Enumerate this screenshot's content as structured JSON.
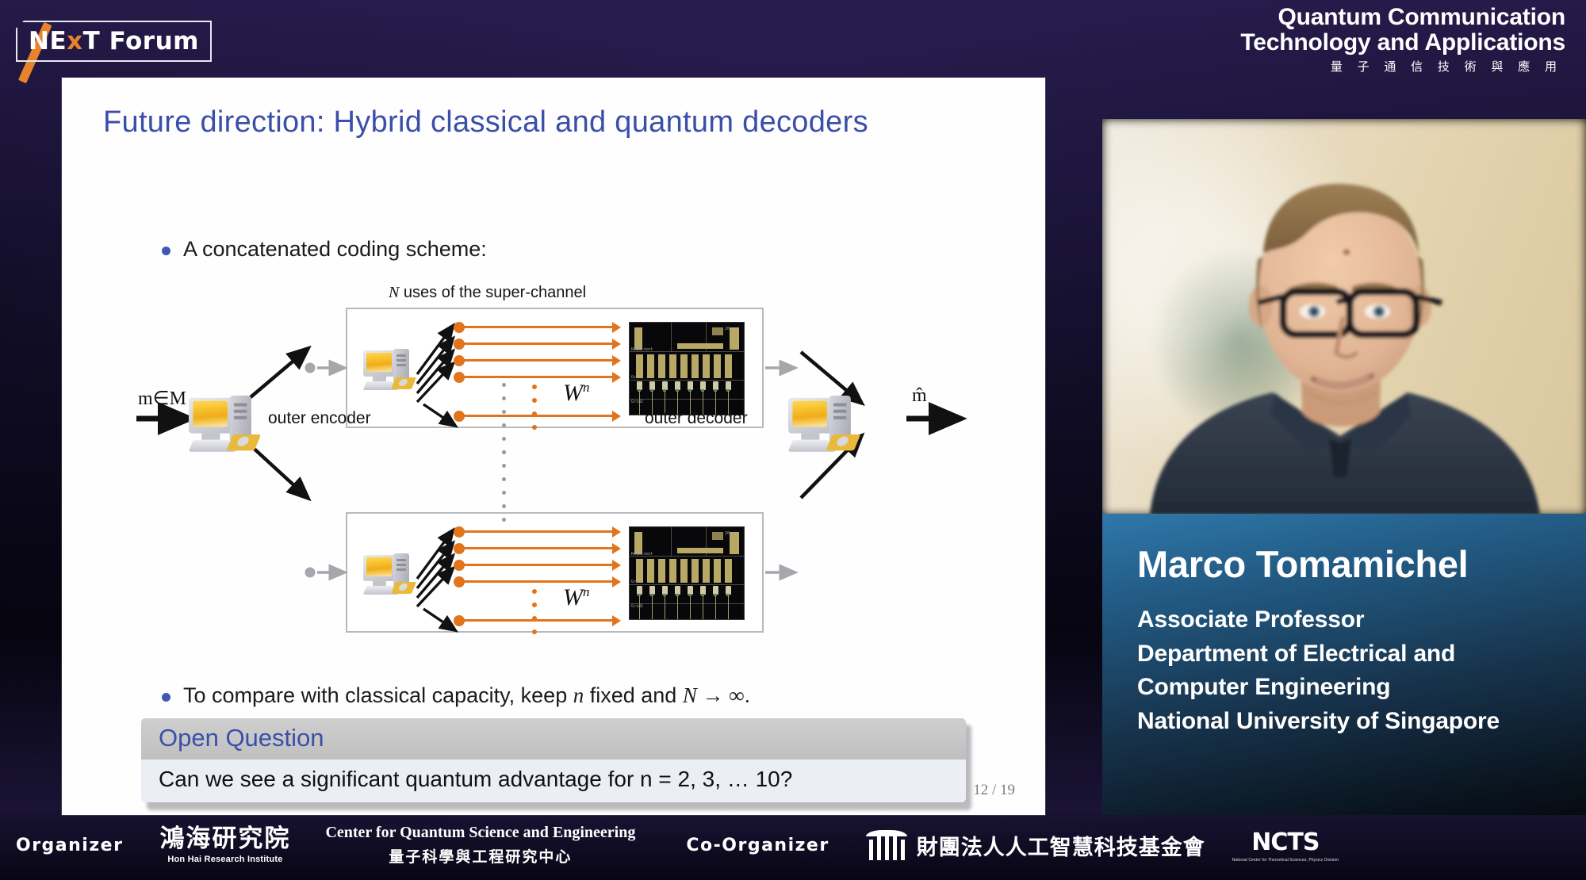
{
  "header": {
    "logo": {
      "pre": "NE",
      "x": "x",
      "post": "T Forum",
      "alt": "NExT Forum"
    },
    "conference": {
      "line1": "Quantum Communication",
      "line2": "Technology and Applications",
      "line3": "量 子 通 信 技 術 與 應 用"
    }
  },
  "slide": {
    "title": "Future direction: Hybrid classical and quantum decoders",
    "bullets": [
      {
        "text_before": "A concatenated coding scheme:"
      },
      {
        "text_before": "To compare with classical capacity, keep ",
        "math1": "n",
        "text_mid": " fixed and ",
        "math2": "N → ∞",
        "text_after": "."
      }
    ],
    "diagram": {
      "supercap_label_math": "N",
      "supercap_label_text": " uses of the super-channel",
      "input_label": "m∈M",
      "output_label": "m̂",
      "encoder_label": "outer encoder",
      "decoder_label": "outer decoder",
      "channel_label": "W",
      "channel_exponent": "n",
      "node_count": 4,
      "chip_labels": [
        "Requirent",
        "Grid",
        "Grid2",
        "20 µm"
      ]
    },
    "open_question": {
      "heading": "Open Question",
      "body": "Can we see a significant quantum advantage for n = 2, 3, … 10?"
    },
    "page_number": "12 / 19"
  },
  "video": {
    "speaker_name": "Marco Tomamichel",
    "affiliation_lines": [
      "Associate Professor",
      "Department of Electrical and",
      "Computer Engineering",
      "National University of Singapore"
    ]
  },
  "footer": {
    "organizer_label": "Organizer",
    "coorganizer_label": "Co-Organizer",
    "honhai": {
      "cn": "鴻海研究院",
      "en": "Hon Hai Research Institute"
    },
    "cqse": {
      "en": "Center for Quantum Science and Engineering",
      "cn": "量子科學與工程研究中心"
    },
    "aif": {
      "name": "財團法人人工智慧科技基金會"
    },
    "ncts": {
      "big": "NCTS",
      "small": "National Center for Theoretical Sciences, Physics Division"
    }
  },
  "colors": {
    "accent_orange": "#e8832a",
    "slide_title_blue": "#3a4fa8",
    "wire_orange": "#e2741c",
    "namecard_blue": "#2f78ab"
  }
}
